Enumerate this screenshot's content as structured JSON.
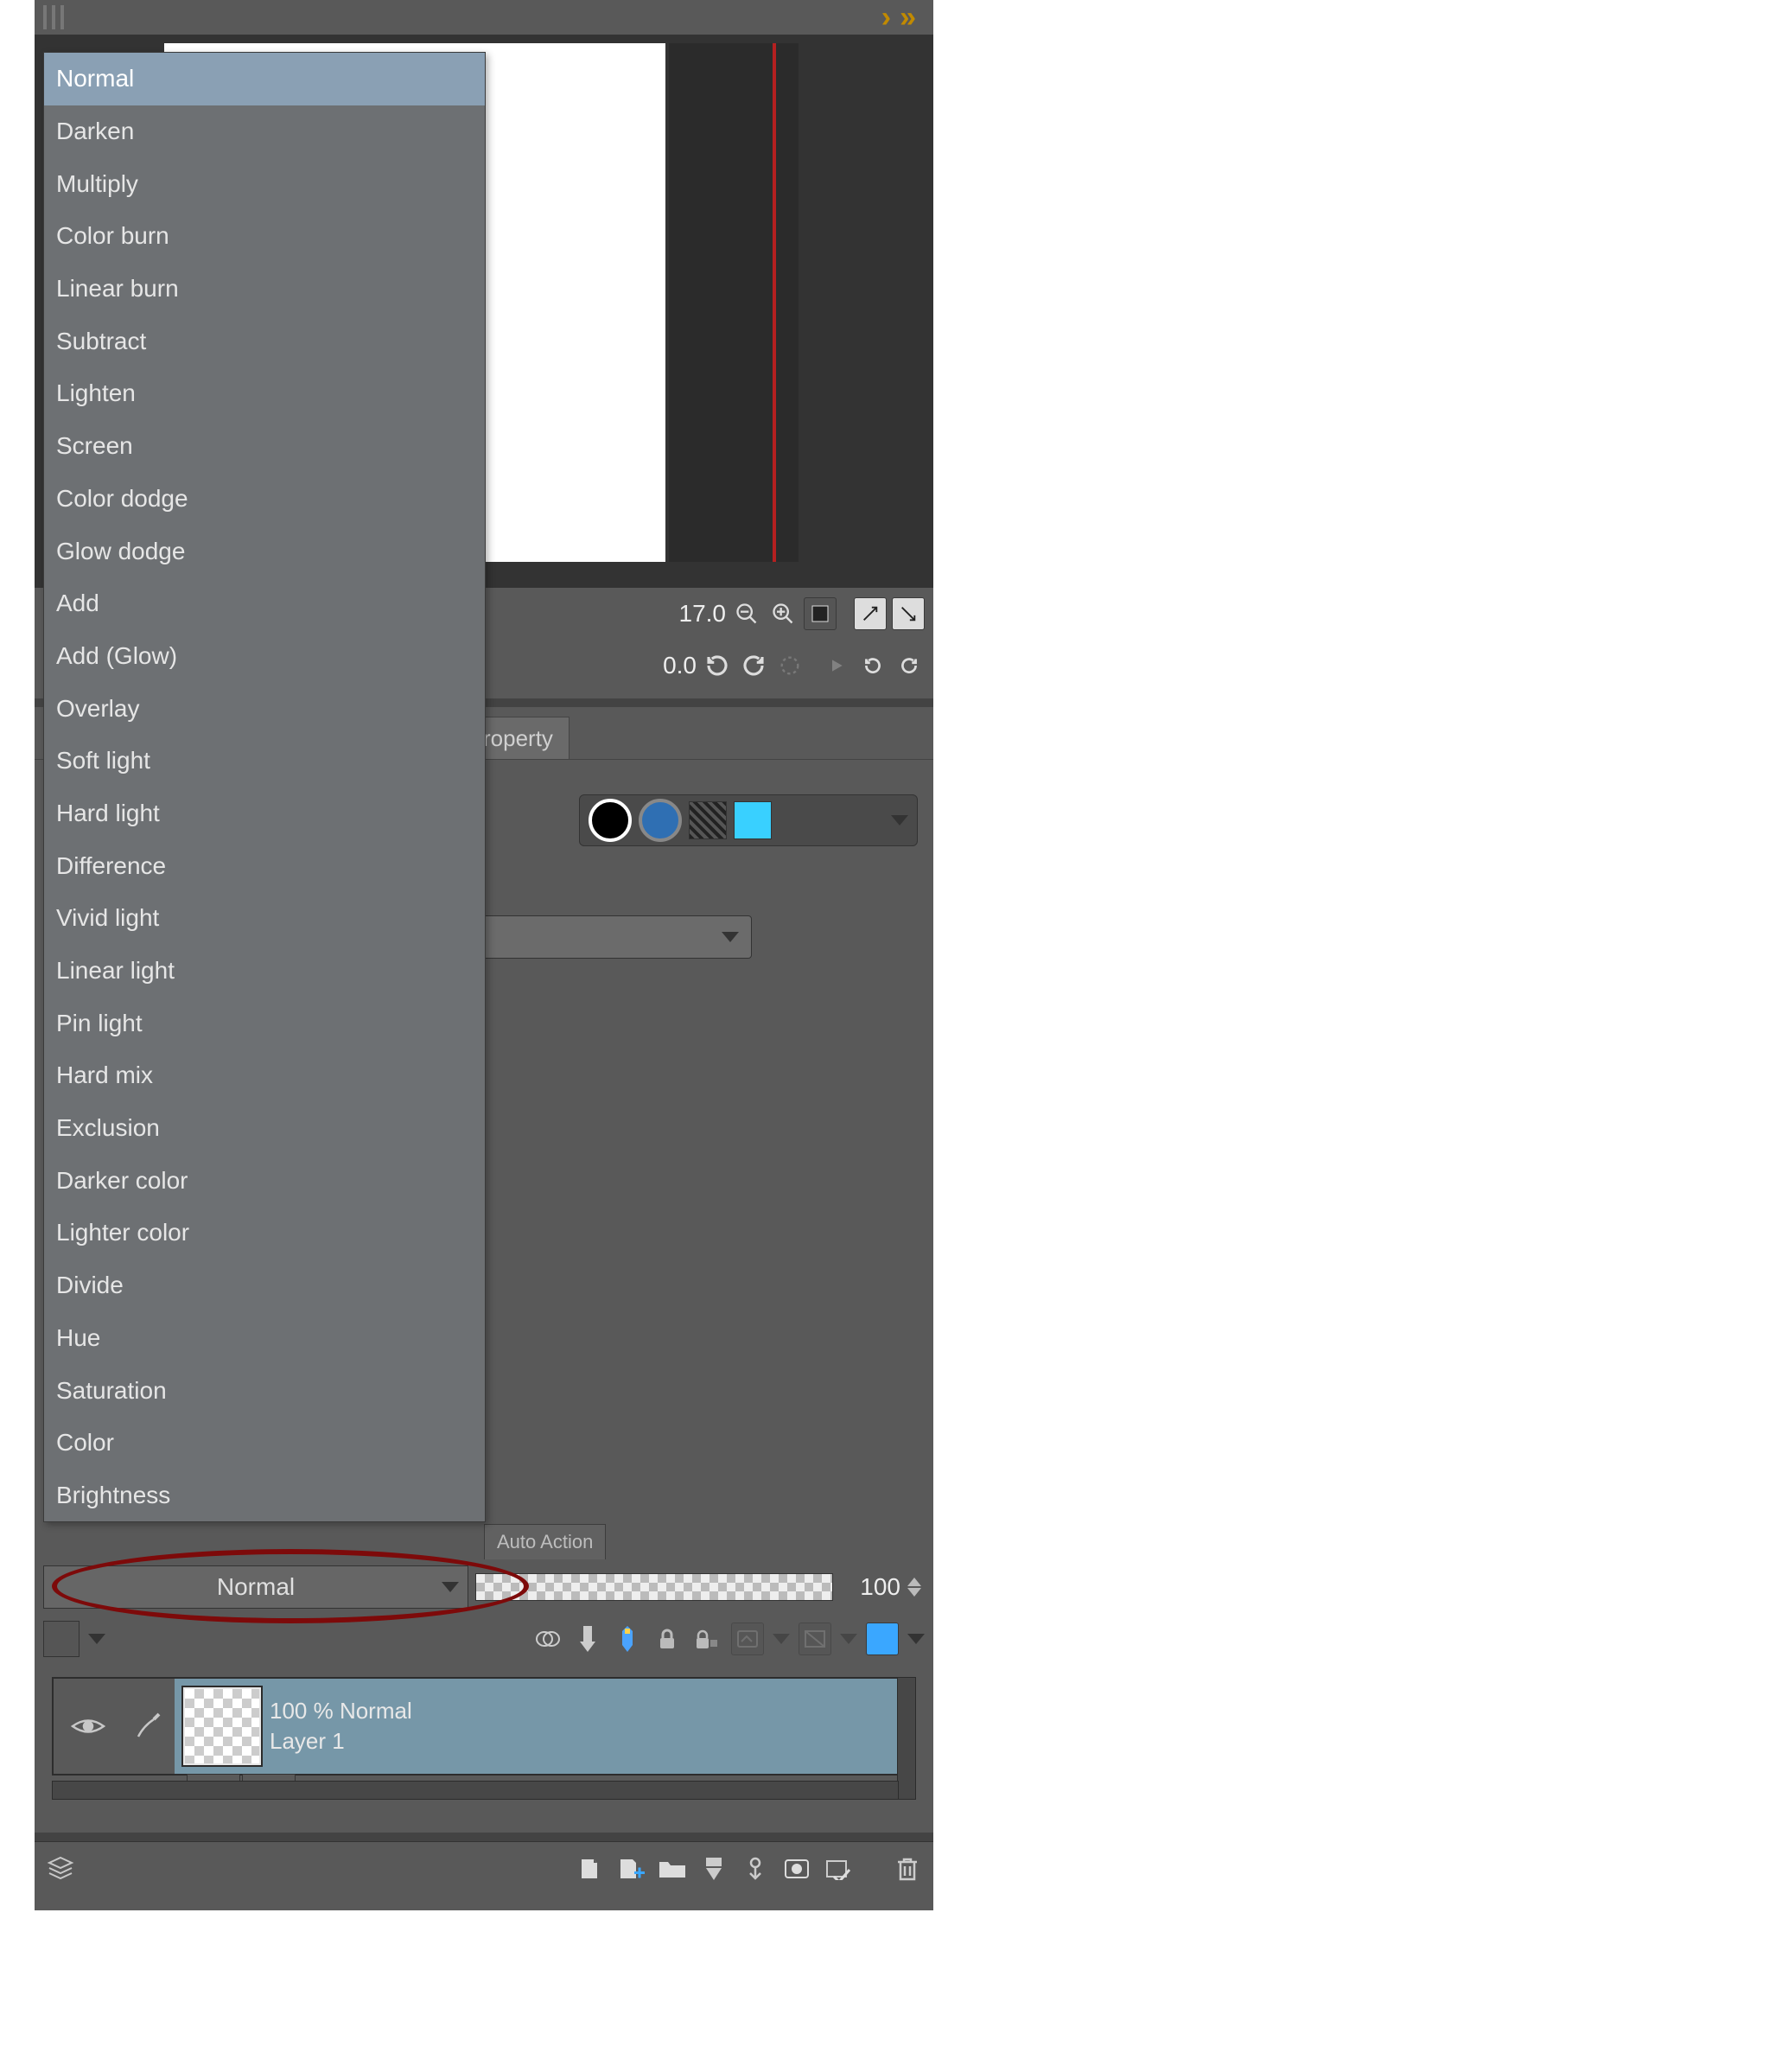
{
  "blend_modes": [
    "Normal",
    "Darken",
    "Multiply",
    "Color burn",
    "Linear burn",
    "Subtract",
    "Lighten",
    "Screen",
    "Color dodge",
    "Glow dodge",
    "Add",
    "Add (Glow)",
    "Overlay",
    "Soft light",
    "Hard light",
    "Difference",
    "Vivid light",
    "Linear light",
    "Pin light",
    "Hard mix",
    "Exclusion",
    "Darker color",
    "Lighter color",
    "Divide",
    "Hue",
    "Saturation",
    "Color",
    "Brightness"
  ],
  "selected_blend_mode": "Normal",
  "tool_values": {
    "value1": "17.0",
    "value2": "0.0"
  },
  "tabs": {
    "property": "roperty",
    "auto_action": "Auto Action"
  },
  "blend_dropdown_label": "Normal",
  "opacity_value": "100",
  "layer": {
    "status": "100 % Normal",
    "name": "Layer 1"
  }
}
